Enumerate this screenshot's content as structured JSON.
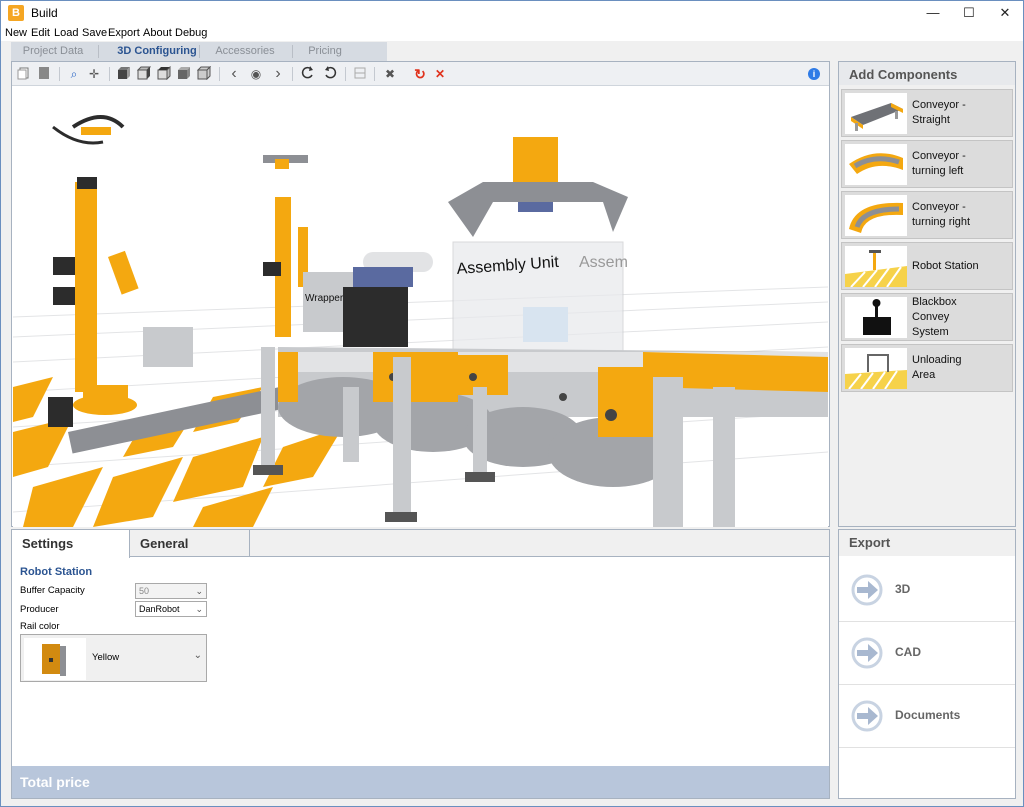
{
  "window": {
    "title": "Build",
    "app_icon_letter": "B",
    "minimize": "—",
    "maximize": "☐",
    "close": "✕"
  },
  "menu": [
    "New",
    "Edit",
    "Load",
    "Save",
    "Export",
    "About",
    "Debug"
  ],
  "top_tabs": [
    {
      "label": "Project Data",
      "active": false
    },
    {
      "label": "3D Configuring",
      "active": true
    },
    {
      "label": "Accessories",
      "active": false
    },
    {
      "label": "Pricing",
      "active": false
    }
  ],
  "toolbar": {
    "icons": [
      "new-doc-icon",
      "page-icon",
      "zoom-icon",
      "pan-icon",
      "cube-front-icon",
      "cube-side-icon",
      "cube-top-icon",
      "cube-iso-icon",
      "cube-back-icon",
      "prev-icon",
      "eye-icon",
      "next-icon",
      "rotate-left-icon",
      "rotate-right-icon",
      "grid-icon",
      "tools-icon",
      "refresh-icon",
      "delete-icon",
      "info-icon"
    ],
    "glyphs": {
      "prev": "‹",
      "next": "›",
      "eye": "◉",
      "refresh": "↻",
      "delete": "✕",
      "info": "i",
      "zoom": "⌕",
      "pan": "✛",
      "tools": "✖"
    },
    "accent_refresh": "#e0321c",
    "accent_delete": "#e0321c",
    "accent_info": "#2f7be6"
  },
  "scene": {
    "labels": {
      "assembly_unit": "Assembly Unit",
      "assembly_mirror": "Assem",
      "wrapper": "Wrapper"
    },
    "colors": {
      "yellow": "#f4a810",
      "grey": "#8d8f94",
      "dark": "#2c2c2c",
      "light": "#c8cacd"
    }
  },
  "bottom_tabs": [
    {
      "label": "Settings",
      "active": true
    },
    {
      "label": "General",
      "active": false
    }
  ],
  "settings": {
    "section_title": "Robot Station",
    "buffer_capacity": {
      "label": "Buffer Capacity",
      "value": "50",
      "disabled": true
    },
    "producer": {
      "label": "Producer",
      "value": "DanRobot"
    },
    "rail_color": {
      "label": "Rail color",
      "value": "Yellow"
    }
  },
  "total_price_label": "Total price",
  "add_components": {
    "header": "Add Components",
    "items": [
      {
        "label": "Conveyor -\nStraight",
        "icon": "conveyor-straight-icon"
      },
      {
        "label": "Conveyor -\nturning left",
        "icon": "conveyor-left-icon"
      },
      {
        "label": "Conveyor -\nturning right",
        "icon": "conveyor-right-icon"
      },
      {
        "label": "Robot Station",
        "icon": "robot-station-icon"
      },
      {
        "label": "Blackbox\nConvey\nSystem",
        "icon": "blackbox-icon"
      },
      {
        "label": "Unloading\nArea",
        "icon": "unloading-area-icon"
      }
    ]
  },
  "export": {
    "header": "Export",
    "items": [
      {
        "label": "3D"
      },
      {
        "label": "CAD"
      },
      {
        "label": "Documents"
      }
    ]
  }
}
